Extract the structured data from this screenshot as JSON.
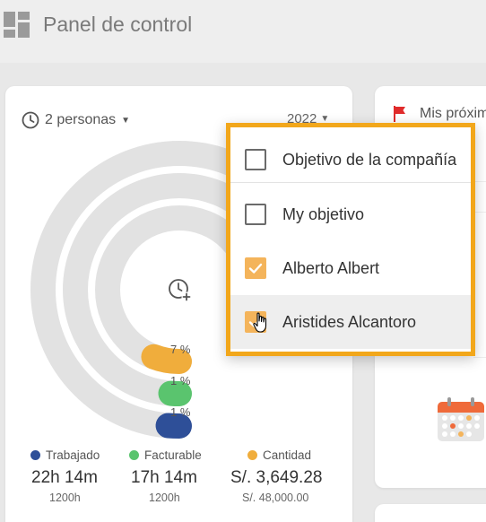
{
  "header": {
    "title": "Panel de control",
    "icon": "dashboard-grid-icon"
  },
  "filters": {
    "persons_label": "2 personas",
    "year_label": "2022"
  },
  "chart_data": {
    "type": "radial-bar",
    "series": [
      {
        "name": "Cantidad",
        "value": 7,
        "label": "7 %",
        "color": "#f0ad3c"
      },
      {
        "name": "Facturable",
        "value": 1,
        "label": "1 %",
        "color": "#5ac46e"
      },
      {
        "name": "Trabajado",
        "value": 1,
        "label": "1 %",
        "color": "#2e4f98"
      }
    ],
    "center_icon": "clock-plus-icon"
  },
  "stats": [
    {
      "legend": "Trabajado",
      "color": "#2e4f98",
      "value": "22h 14m",
      "target": "1200h"
    },
    {
      "legend": "Facturable",
      "color": "#5ac46e",
      "value": "17h 14m",
      "target": "1200h"
    },
    {
      "legend": "Cantidad",
      "color": "#f0ad3c",
      "value": "S/. 3,649.28",
      "target": "S/. 48,000.00"
    }
  ],
  "right_panel": {
    "title": "Mis próxim",
    "flag_color": "#e02b2b",
    "icon": "calendar-icon"
  },
  "dropdown": {
    "accent": "#f2a71b",
    "options": [
      {
        "label": "Objetivo de la compañía",
        "checked": false
      },
      {
        "label": "My objetivo",
        "checked": false
      },
      {
        "label": "Alberto Albert",
        "checked": true
      },
      {
        "label": "Aristides Alcantoro",
        "checked": true
      }
    ]
  }
}
